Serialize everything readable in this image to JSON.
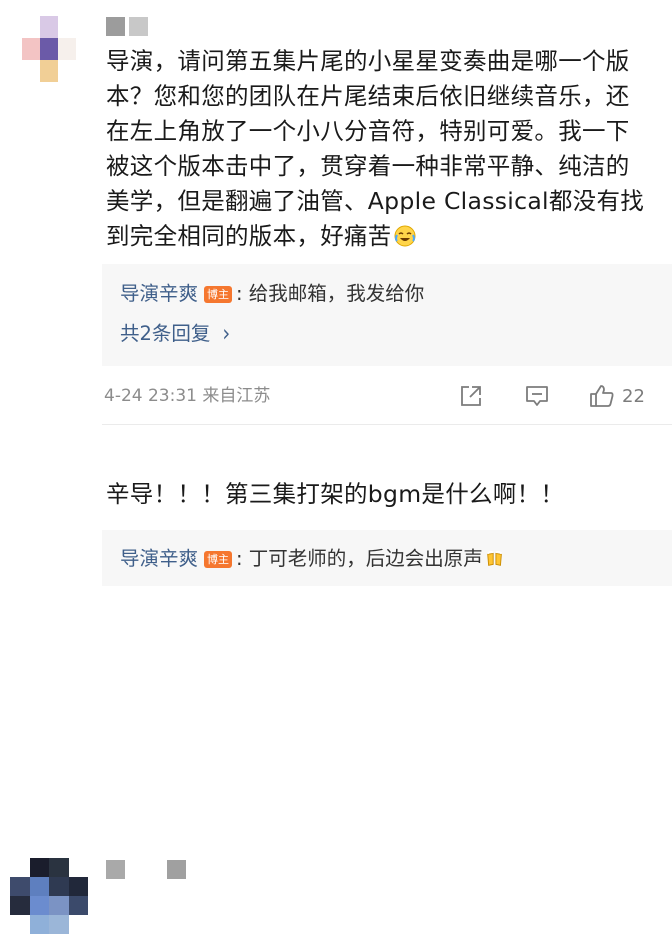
{
  "comments": [
    {
      "text": "导演，请问第五集片尾的小星星变奏曲是哪一个版本？您和您的团队在片尾结束后依旧继续音乐，还在左上角放了一个小八分音符，特别可爱。我一下被这个版本击中了，贯穿着一种非常平静、纯洁的美学，但是翻遍了油管、Apple Classical都没有找到完全相同的版本，好痛苦",
      "emoji": "crying-laughing-emoji",
      "reply": {
        "name": "导演辛爽",
        "badge": "博主",
        "text": ": 给我邮箱，我发给你"
      },
      "more_replies": "共2条回复",
      "time_location": "4-24 23:31 来自江苏",
      "likes": "22"
    },
    {
      "text": "辛导！！！第三集打架的bgm是什么啊！！",
      "reply": {
        "name": "导演辛爽",
        "badge": "博主",
        "text": ": 丁可老师的，后边会出原声",
        "emoji": "cheers-emoji"
      }
    }
  ],
  "colors": {
    "link": "#3f5f8a",
    "badge": "#f5772f",
    "meta": "#8c8c8c",
    "reply_bg": "#f7f7f7"
  }
}
